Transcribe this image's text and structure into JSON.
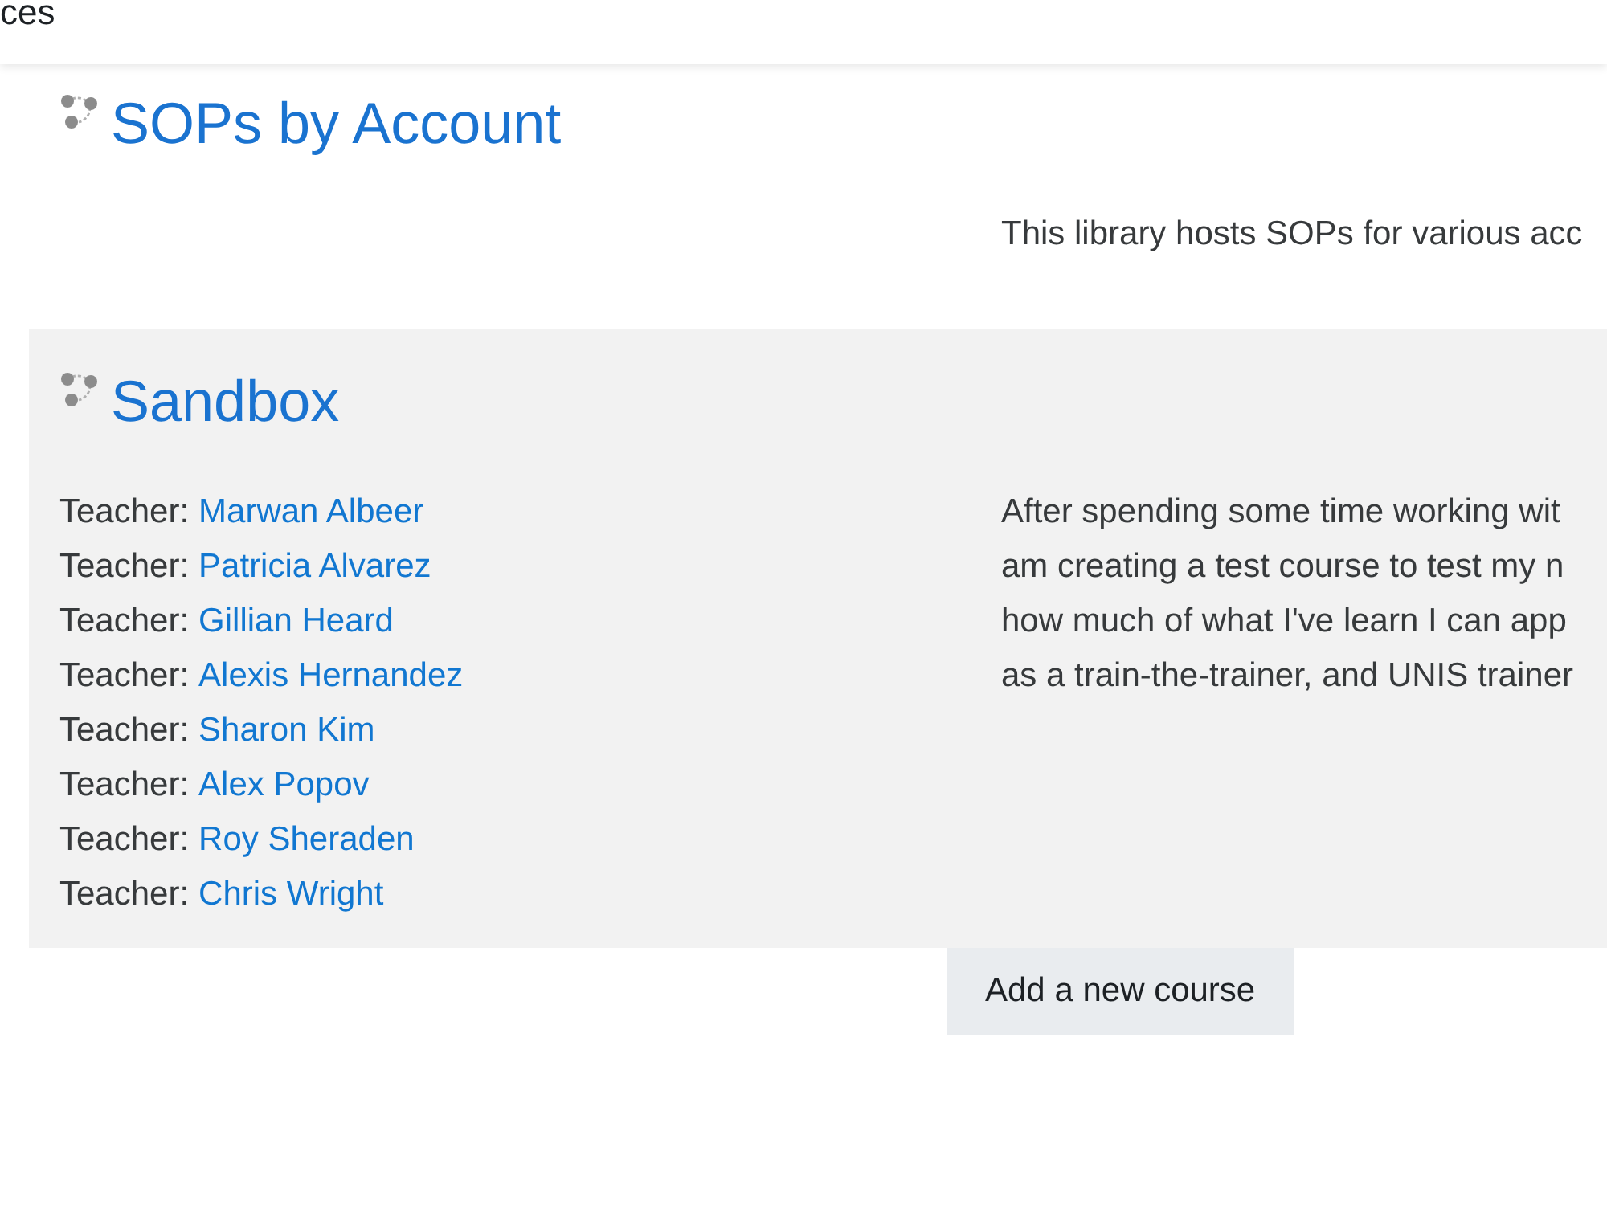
{
  "header": {
    "title_fragment": "ces"
  },
  "courses": [
    {
      "name": "SOPs by Account",
      "summary_lines": [
        "This library hosts SOPs for various acc"
      ]
    },
    {
      "name": "Sandbox",
      "teachers": [
        {
          "role": "Teacher:",
          "name": "Marwan Albeer"
        },
        {
          "role": "Teacher:",
          "name": "Patricia Alvarez"
        },
        {
          "role": "Teacher:",
          "name": "Gillian Heard"
        },
        {
          "role": "Teacher:",
          "name": "Alexis Hernandez"
        },
        {
          "role": "Teacher:",
          "name": "Sharon Kim"
        },
        {
          "role": "Teacher:",
          "name": "Alex Popov"
        },
        {
          "role": "Teacher:",
          "name": "Roy Sheraden"
        },
        {
          "role": "Teacher:",
          "name": "Chris Wright"
        }
      ],
      "summary_lines": [
        "After spending some time working wit",
        "am creating a test course to test my n",
        "how much of what I've learn I can app",
        "as a train-the-trainer, and UNIS trainer"
      ]
    }
  ],
  "buttons": [
    {
      "label": "Add a new course"
    }
  ]
}
